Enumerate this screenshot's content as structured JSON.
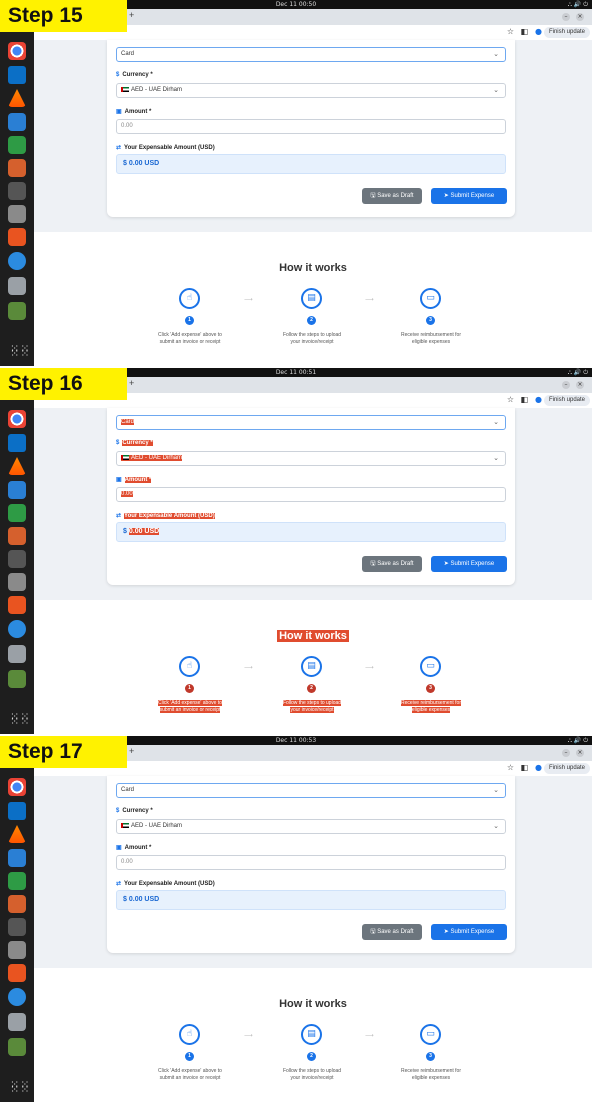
{
  "colors": {
    "accent": "#1a73e8",
    "highlight": "#e04c2f",
    "step_banner": "#fff200"
  },
  "dock": {
    "icons": [
      "chrome-icon",
      "vscode-icon",
      "vlc-icon",
      "writer-icon",
      "calc-icon",
      "impress-icon",
      "terminal-icon",
      "files-icon",
      "software-icon",
      "help-icon",
      "save-icon",
      "trash-icon"
    ]
  },
  "browser": {
    "new_tab": "+",
    "finish_update": "Finish update"
  },
  "form": {
    "payment_value": "Card",
    "currency_label": "Currency *",
    "currency_value": "AED - UAE Dirham",
    "amount_label": "Amount *",
    "amount_placeholder": "0.00",
    "expensable_label": "Your Expensable Amount (USD)",
    "expensable_prefix": "$",
    "expensable_value": "0.00 USD",
    "save_draft": "Save as Draft",
    "submit": "Submit Expense"
  },
  "how": {
    "title": "How it works",
    "steps": [
      {
        "num": "1",
        "l1": "Click 'Add expense' above to",
        "l2": "submit an invoice or receipt"
      },
      {
        "num": "2",
        "l1": "Follow the steps to upload",
        "l2": "your invoice/receipt"
      },
      {
        "num": "3",
        "l1": "Receive reimbursement for",
        "l2": "eligible expenses"
      }
    ]
  },
  "panels": [
    {
      "step": "Step 15",
      "time": "Dec 11  00:50"
    },
    {
      "step": "Step 16",
      "time": "Dec 11  00:51"
    },
    {
      "step": "Step 17",
      "time": "Dec 11  00:53"
    }
  ]
}
